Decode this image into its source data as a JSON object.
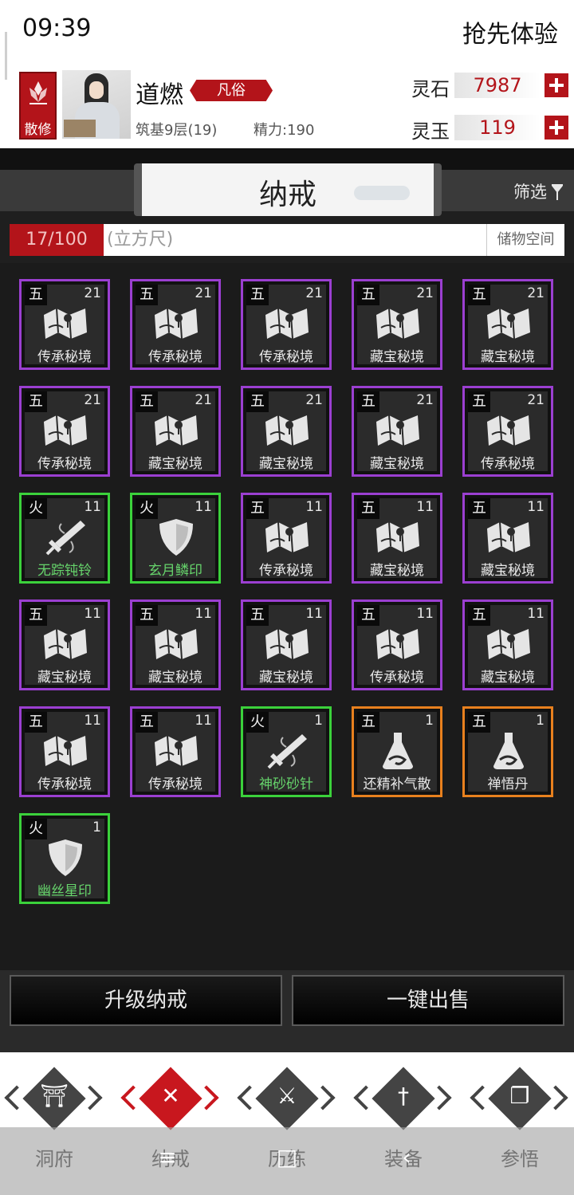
{
  "status": {
    "time": "09:39",
    "experience": "抢先体验"
  },
  "player": {
    "sect": "散修",
    "name": "道燃",
    "realm_tag": "凡俗",
    "stage": "筑基9层(19)",
    "energy": "精力:190"
  },
  "currency": {
    "spirit_stone": {
      "label": "灵石",
      "value": "7987"
    },
    "spirit_jade": {
      "label": "灵玉",
      "value": "119"
    }
  },
  "ring": {
    "title": "纳戒",
    "filter_label": "筛选",
    "capacity": "17/100",
    "capacity_unit": "(立方尺)",
    "storage_tab": "储物空间"
  },
  "items": [
    {
      "grade": "五",
      "count": "21",
      "name": "传承秘境",
      "rarity": "purple",
      "icon": "map-scroll-icon"
    },
    {
      "grade": "五",
      "count": "21",
      "name": "传承秘境",
      "rarity": "purple",
      "icon": "map-scroll-icon"
    },
    {
      "grade": "五",
      "count": "21",
      "name": "传承秘境",
      "rarity": "purple",
      "icon": "map-scroll-icon"
    },
    {
      "grade": "五",
      "count": "21",
      "name": "藏宝秘境",
      "rarity": "purple",
      "icon": "map-scroll-icon"
    },
    {
      "grade": "五",
      "count": "21",
      "name": "藏宝秘境",
      "rarity": "purple",
      "icon": "map-scroll-icon"
    },
    {
      "grade": "五",
      "count": "21",
      "name": "传承秘境",
      "rarity": "purple",
      "icon": "map-scroll-icon"
    },
    {
      "grade": "五",
      "count": "21",
      "name": "藏宝秘境",
      "rarity": "purple",
      "icon": "map-scroll-icon"
    },
    {
      "grade": "五",
      "count": "21",
      "name": "藏宝秘境",
      "rarity": "purple",
      "icon": "map-scroll-icon"
    },
    {
      "grade": "五",
      "count": "21",
      "name": "藏宝秘境",
      "rarity": "purple",
      "icon": "map-scroll-icon"
    },
    {
      "grade": "五",
      "count": "21",
      "name": "传承秘境",
      "rarity": "purple",
      "icon": "map-scroll-icon"
    },
    {
      "grade": "火",
      "count": "11",
      "name": "无踪钝铃",
      "rarity": "green",
      "icon": "sword-icon"
    },
    {
      "grade": "火",
      "count": "11",
      "name": "玄月鳞印",
      "rarity": "green",
      "icon": "shield-icon"
    },
    {
      "grade": "五",
      "count": "11",
      "name": "传承秘境",
      "rarity": "purple",
      "icon": "map-scroll-icon"
    },
    {
      "grade": "五",
      "count": "11",
      "name": "藏宝秘境",
      "rarity": "purple",
      "icon": "map-scroll-icon"
    },
    {
      "grade": "五",
      "count": "11",
      "name": "藏宝秘境",
      "rarity": "purple",
      "icon": "map-scroll-icon"
    },
    {
      "grade": "五",
      "count": "11",
      "name": "藏宝秘境",
      "rarity": "purple",
      "icon": "map-scroll-icon"
    },
    {
      "grade": "五",
      "count": "11",
      "name": "藏宝秘境",
      "rarity": "purple",
      "icon": "map-scroll-icon"
    },
    {
      "grade": "五",
      "count": "11",
      "name": "藏宝秘境",
      "rarity": "purple",
      "icon": "map-scroll-icon"
    },
    {
      "grade": "五",
      "count": "11",
      "name": "传承秘境",
      "rarity": "purple",
      "icon": "map-scroll-icon"
    },
    {
      "grade": "五",
      "count": "11",
      "name": "藏宝秘境",
      "rarity": "purple",
      "icon": "map-scroll-icon"
    },
    {
      "grade": "五",
      "count": "11",
      "name": "传承秘境",
      "rarity": "purple",
      "icon": "map-scroll-icon"
    },
    {
      "grade": "五",
      "count": "11",
      "name": "传承秘境",
      "rarity": "purple",
      "icon": "map-scroll-icon"
    },
    {
      "grade": "火",
      "count": "1",
      "name": "神砂砂针",
      "rarity": "green",
      "icon": "sword-icon"
    },
    {
      "grade": "五",
      "count": "1",
      "name": "还精补气散",
      "rarity": "orange",
      "icon": "potion-flask-icon"
    },
    {
      "grade": "五",
      "count": "1",
      "name": "禅悟丹",
      "rarity": "orange",
      "icon": "potion-flask-icon"
    },
    {
      "grade": "火",
      "count": "1",
      "name": "幽丝星印",
      "rarity": "green",
      "icon": "shield-icon"
    }
  ],
  "actions": {
    "upgrade": "升级纳戒",
    "sell_all": "一键出售"
  },
  "nav": [
    {
      "label": "洞府",
      "icon": "gate-icon",
      "active": false
    },
    {
      "label": "纳戒",
      "icon": "close-x-icon",
      "active": true
    },
    {
      "label": "历练",
      "icon": "crossed-swords-icon",
      "active": false
    },
    {
      "label": "装备",
      "icon": "dagger-icon",
      "active": false
    },
    {
      "label": "参悟",
      "icon": "open-book-icon",
      "active": false
    }
  ],
  "colors": {
    "accent_red": "#b3141a",
    "rarity_purple": "#9b3fd1",
    "rarity_green": "#3bd13b",
    "rarity_orange": "#e8801e"
  }
}
